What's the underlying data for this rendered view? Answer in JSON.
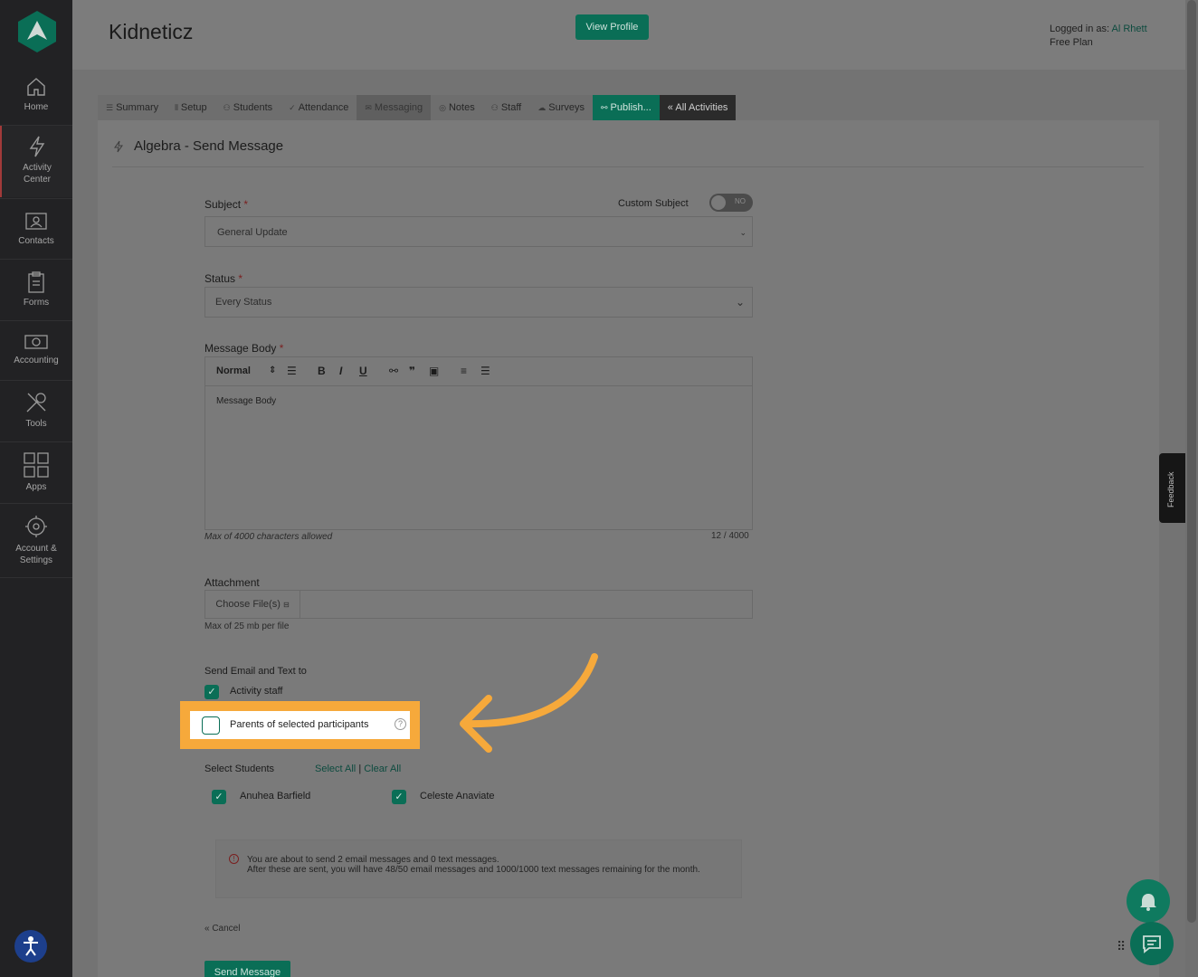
{
  "colors": {
    "brand": "#0a6e56",
    "highlight": "#f6a93b",
    "sidebar": "#222224"
  },
  "sidebar": {
    "items": [
      {
        "label": "Home",
        "icon": "home-icon"
      },
      {
        "label": "Activity Center",
        "icon": "lightning-icon"
      },
      {
        "label": "Contacts",
        "icon": "contacts-icon"
      },
      {
        "label": "Forms",
        "icon": "clipboard-icon"
      },
      {
        "label": "Accounting",
        "icon": "money-icon"
      },
      {
        "label": "Tools",
        "icon": "tools-icon"
      },
      {
        "label": "Apps",
        "icon": "grid-icon"
      },
      {
        "label": "Account & Settings",
        "icon": "gear-icon"
      }
    ]
  },
  "header": {
    "brand": "Kidneticz",
    "view_profile": "View Profile",
    "logged_in_label": "Logged in as:",
    "user": "Al Rhett",
    "plan": "Free Plan"
  },
  "tabs": [
    {
      "label": "Summary"
    },
    {
      "label": "Setup"
    },
    {
      "label": "Students"
    },
    {
      "label": "Attendance"
    },
    {
      "label": "Messaging"
    },
    {
      "label": "Notes"
    },
    {
      "label": "Staff"
    },
    {
      "label": "Surveys"
    },
    {
      "label": "Publish..."
    },
    {
      "label": "« All Activities"
    }
  ],
  "page_title": "Algebra - Send Message",
  "form": {
    "subject_label": "Subject",
    "custom_subject_label": "Custom Subject",
    "custom_subject_toggle": "NO",
    "subject_value": "General Update",
    "status_label": "Status",
    "status_value": "Every Status",
    "message_body_label": "Message Body",
    "editor_format": "Normal",
    "message_body_placeholder": "Message Body",
    "char_limit_note": "Max of 4000 characters allowed",
    "char_count": "12 / 4000",
    "attachment_label": "Attachment",
    "choose_files": "Choose File(s)",
    "attachment_note": "Max of 25 mb per file",
    "send_to_label": "Send Email and Text to",
    "activity_staff": "Activity staff",
    "parents_label": "Parents of selected participants",
    "select_students_label": "Select Students",
    "select_all": "Select All",
    "separator": "|",
    "clear_all": "Clear All",
    "students": [
      "Anuhea Barfield",
      "Celeste Anaviate"
    ],
    "notice_line1": "You are about to send 2 email messages and 0 text messages.",
    "notice_line2": "After these are sent, you will have 48/50 email messages and 1000/1000 text messages remaining for the month.",
    "cancel": "« Cancel",
    "send_button": "Send Message"
  },
  "feedback_label": "Feedback"
}
